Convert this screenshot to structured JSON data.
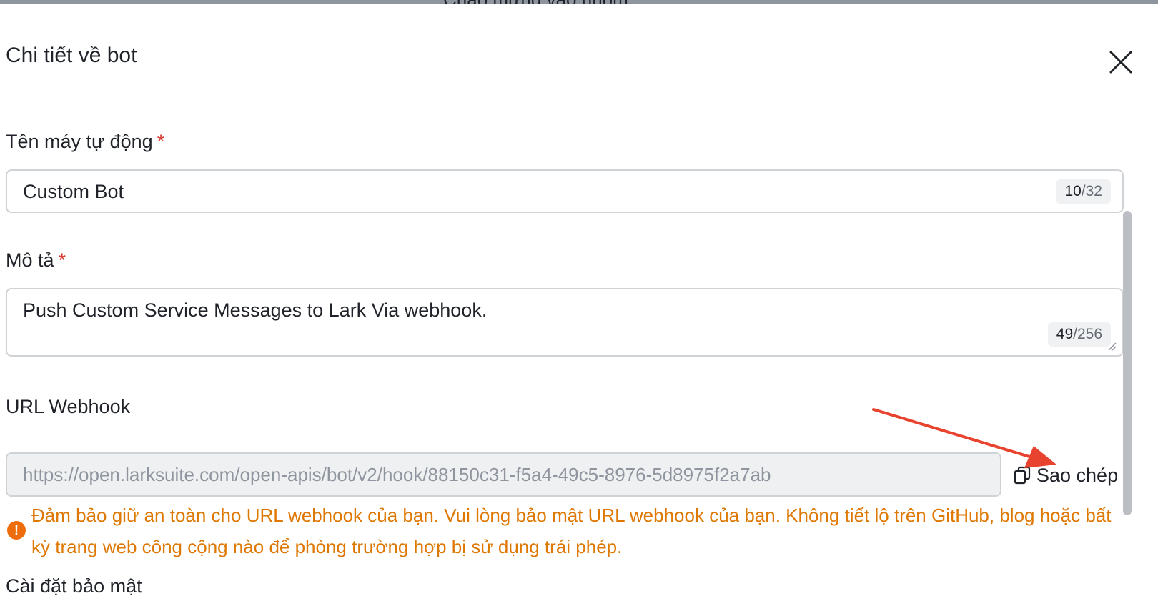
{
  "background_title": "Chào mừng vào nhóm",
  "dialog": {
    "title": "Chi tiết về bot"
  },
  "fields": {
    "name": {
      "label": "Tên máy tự động",
      "required_mark": "*",
      "value": "Custom Bot",
      "count": "10",
      "max": "/32"
    },
    "description": {
      "label": "Mô tả",
      "required_mark": "*",
      "value": "Push Custom Service Messages to Lark Via webhook.",
      "count": "49",
      "max": "/256"
    },
    "webhook": {
      "label": "URL Webhook",
      "value": "https://open.larksuite.com/open-apis/bot/v2/hook/88150c31-f5a4-49c5-8976-5d8975f2a7ab",
      "copy_label": "Sao chép",
      "warning_icon": "!",
      "warning": "Đảm bảo giữ an toàn cho URL webhook của bạn. Vui lòng bảo mật URL webhook của bạn. Không tiết lộ trên GitHub, blog hoặc bất kỳ trang web công cộng nào để phòng trường hợp bị sử dụng trái phép."
    },
    "security": {
      "label": "Cài đặt bảo mật"
    }
  },
  "icons": {
    "close": "close-icon",
    "copy": "copy-icon",
    "warning": "warning-icon",
    "annotation": "red-arrow-annotation"
  },
  "colors": {
    "required": "#d83931",
    "warning": "#de7802",
    "annotation_arrow": "#e8432e"
  }
}
